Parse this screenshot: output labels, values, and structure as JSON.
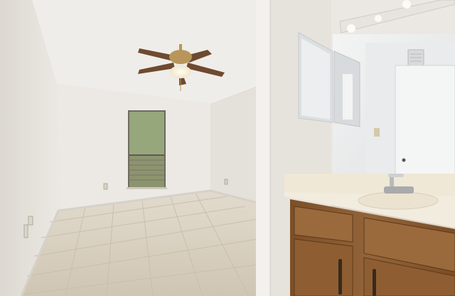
{
  "scene": {
    "kind": "photo",
    "room": "bedroom-with-vanity",
    "colors": {
      "wall": "#e9e6e1",
      "wall_shadow": "#d5d0c8",
      "ceiling": "#eeece8",
      "floor": "#d8cfbf",
      "grout": "#c6bca9",
      "window_glass": "#8f9a78",
      "cabinet": "#8a5a2e",
      "cabinet_dark": "#6b4220",
      "counter": "#f1ebdc",
      "mirror": "#e8ebee",
      "fan_blade": "#6e4a30",
      "fan_brass": "#b8965a"
    }
  }
}
